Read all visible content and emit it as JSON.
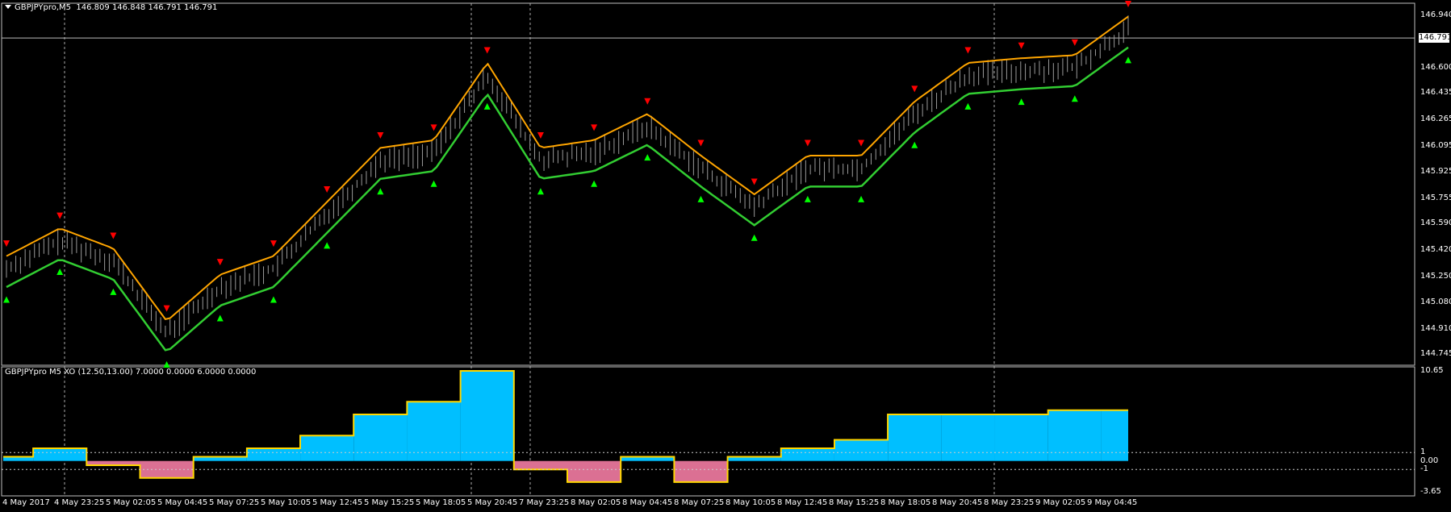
{
  "main_chart": {
    "symbol_label": "GBPJPYpro,M5",
    "ohlc": "146.809 146.848 146.791 146.791",
    "current_price": "146.791",
    "price_axis": [
      "146.940",
      "146.600",
      "146.435",
      "146.265",
      "146.095",
      "145.925",
      "145.755",
      "145.590",
      "145.420",
      "145.250",
      "145.080",
      "144.910",
      "144.745"
    ],
    "price_range": [
      144.7,
      146.99
    ]
  },
  "sub_chart": {
    "title": "GBPJPYpro M5 XO (12.50,13.00) 7.0000 0.0000 6.0000 0.0000",
    "axis": [
      "10.65",
      "1",
      "0.00",
      "-1",
      "-3.65"
    ],
    "range": [
      -3.65,
      10.65
    ]
  },
  "time_axis": [
    "4 May 2017",
    "4 May 23:25",
    "5 May 02:05",
    "5 May 04:45",
    "5 May 07:25",
    "5 May 10:05",
    "5 May 12:45",
    "5 May 15:25",
    "5 May 18:05",
    "5 May 20:45",
    "7 May 23:25",
    "8 May 02:05",
    "8 May 04:45",
    "8 May 07:25",
    "8 May 10:05",
    "8 May 12:45",
    "8 May 15:25",
    "8 May 18:05",
    "8 May 20:45",
    "8 May 23:25",
    "9 May 02:05",
    "9 May 04:45"
  ],
  "chart_data": {
    "type": "line",
    "x": [
      "4 May 2017",
      "4 May 23:25",
      "5 May 02:05",
      "5 May 04:45",
      "5 May 07:25",
      "5 May 10:05",
      "5 May 12:45",
      "5 May 15:25",
      "5 May 18:05",
      "5 May 20:45",
      "7 May 23:25",
      "8 May 02:05",
      "8 May 04:45",
      "8 May 07:25",
      "8 May 10:05",
      "8 May 12:45",
      "8 May 15:25",
      "8 May 18:05",
      "8 May 20:45",
      "8 May 23:25",
      "9 May 02:05",
      "9 May 04:45"
    ],
    "close": [
      145.3,
      145.48,
      145.35,
      144.88,
      145.18,
      145.3,
      145.65,
      146.0,
      146.05,
      146.55,
      146.0,
      146.05,
      146.22,
      145.95,
      145.7,
      145.95,
      145.95,
      146.3,
      146.55,
      146.58,
      146.6,
      146.85
    ],
    "indicator_xo": [
      0.5,
      1.5,
      -0.5,
      -2.0,
      0.5,
      1.5,
      3.0,
      5.5,
      7.0,
      10.65,
      -1.0,
      -2.5,
      0.5,
      -2.5,
      0.5,
      1.5,
      2.5,
      5.5,
      5.5,
      5.5,
      6.0,
      6.0
    ],
    "colors": {
      "bull": "#00bfff",
      "bear": "#db7093",
      "support": "#32cd32",
      "resistance": "#ffa500",
      "up_arrow": "#00ff00",
      "down_arrow": "#ff0000"
    }
  }
}
